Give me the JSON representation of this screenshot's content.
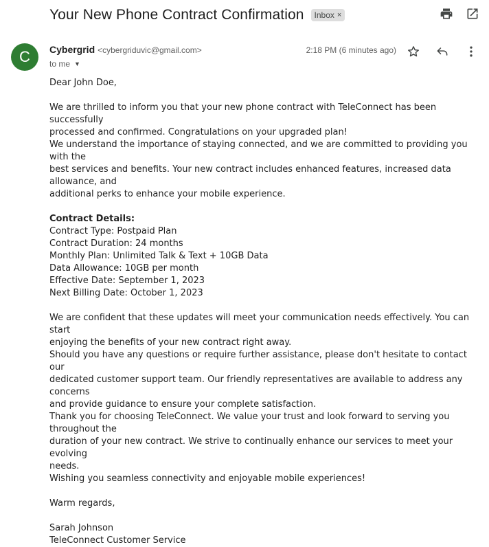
{
  "email": {
    "subject": "Your New Phone Contract Confirmation",
    "label": "Inbox",
    "sender_initial": "C",
    "sender_name": "Cybergrid",
    "sender_email": "<cybergriduvic@gmail.com>",
    "recipient": "to me",
    "time": "2:18 PM (6 minutes ago)"
  },
  "icons": {
    "print": "print-icon",
    "open_new": "open-in-new-window-icon",
    "star": "star-icon",
    "reply": "reply-icon",
    "more": "more-vertical-icon"
  },
  "body": {
    "greeting": "Dear John Doe,",
    "p1_l1": "We are thrilled to inform you that your new phone contract with TeleConnect has been successfully",
    "p1_l2": "processed and confirmed. Congratulations on your upgraded plan!",
    "p1_l3": "We understand the importance of staying connected, and we are committed to providing you with the",
    "p1_l4": "best services and benefits. Your new contract includes enhanced features, increased data allowance, and",
    "p1_l5": "additional perks to enhance your mobile experience.",
    "details_heading": "Contract Details:",
    "details": [
      "Contract Type: Postpaid Plan",
      "Contract Duration: 24 months",
      "Monthly Plan: Unlimited Talk & Text + 10GB Data",
      "Data Allowance: 10GB per month",
      "Effective Date: September 1, 2023",
      "Next Billing Date: October 1, 2023"
    ],
    "p2": [
      "We are confident that these updates will meet your communication needs effectively. You can start",
      "enjoying the benefits of your new contract right away.",
      "Should you have any questions or require further assistance, please don't hesitate to contact our",
      "dedicated customer support team. Our friendly representatives are available to address any concerns",
      "and provide guidance to ensure your complete satisfaction.",
      "Thank you for choosing TeleConnect. We value your trust and look forward to serving you throughout the",
      "duration of your new contract. We strive to continually enhance our services to meet your evolving",
      "needs.",
      "Wishing you seamless connectivity and enjoyable mobile experiences!"
    ],
    "closing": "Warm regards,",
    "signature_name": "Sarah Johnson",
    "signature_org": "TeleConnect Customer Service"
  }
}
